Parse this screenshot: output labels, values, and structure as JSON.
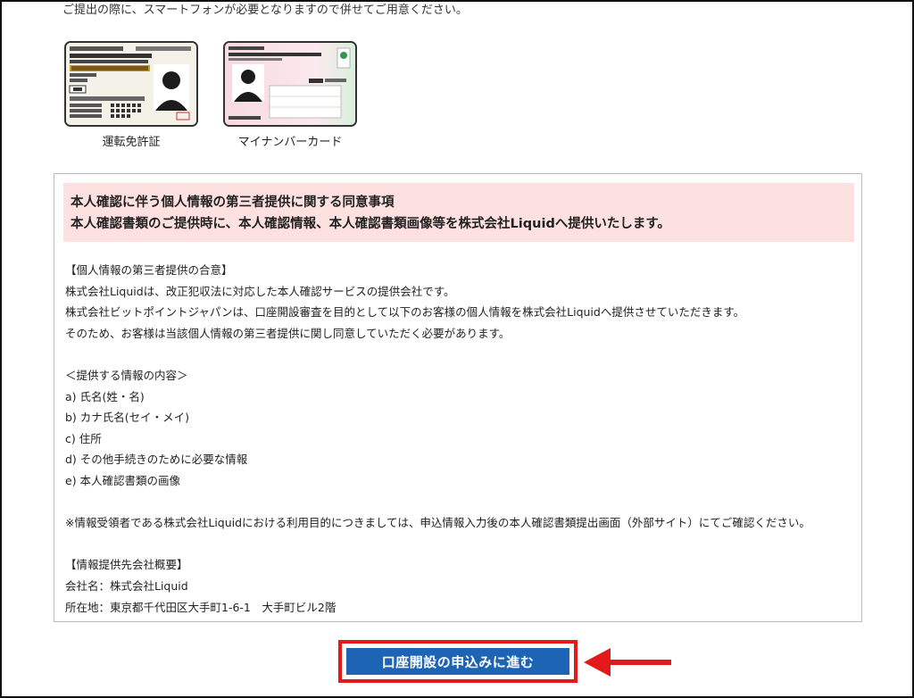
{
  "intro": {
    "note": "ご提出の際に、スマートフォンが必要となりますので併せてご用意ください。"
  },
  "documents": [
    {
      "caption": "運転免許証",
      "icon": "drivers-license-card"
    },
    {
      "caption": "マイナンバーカード",
      "icon": "my-number-card"
    }
  ],
  "consent": {
    "title_line1": "本人確認に伴う個人情報の第三者提供に関する同意事項",
    "title_line2": "本人確認書類のご提供時に、本人確認情報、本人確認書類画像等を株式会社Liquidへ提供いたします。",
    "lines": [
      "【個人情報の第三者提供の合意】",
      "株式会社Liquidは、改正犯収法に対応した本人確認サービスの提供会社です。",
      "株式会社ビットポイントジャパンは、口座開設審査を目的として以下のお客様の個人情報を株式会社Liquidへ提供させていただきます。",
      "そのため、お客様は当該個人情報の第三者提供に関し同意していただく必要があります。",
      "",
      "＜提供する情報の内容＞",
      "a) 氏名(姓・名)",
      "b) カナ氏名(セイ・メイ)",
      "c) 住所",
      "d) その他手続きのために必要な情報",
      "e) 本人確認書類の画像",
      "",
      "※情報受領者である株式会社Liquidにおける利用目的につきましては、申込情報入力後の本人確認書類提出画面（外部サイト）にてご確認ください。",
      "",
      "【情報提供先会社概要】",
      "会社名：株式会社Liquid",
      "所在地：東京都千代田区大手町1-6-1　大手町ビル2階"
    ]
  },
  "cta": {
    "label": "口座開設の申込みに進む"
  },
  "colors": {
    "consent_bg": "#fde1e1",
    "cta_bg": "#1e64b4",
    "highlight": "#e21a1a"
  }
}
